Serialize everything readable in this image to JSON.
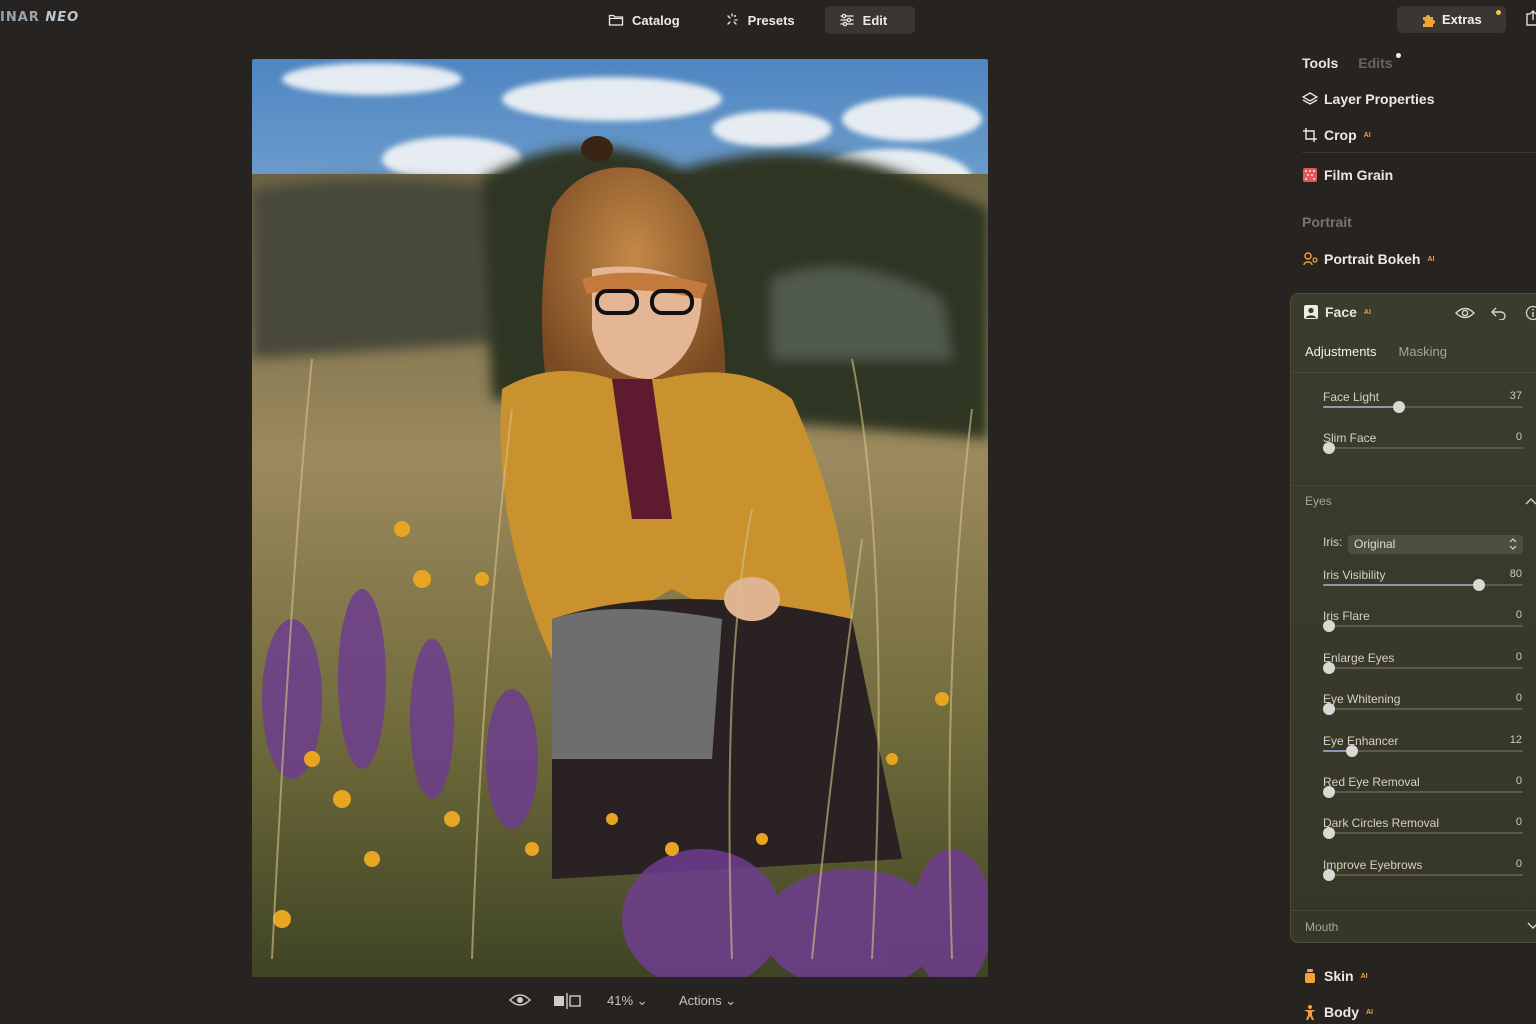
{
  "app": {
    "logo_left": "INAR",
    "logo_right": "NEO"
  },
  "topnav": {
    "catalog": "Catalog",
    "presets": "Presets",
    "edit": "Edit",
    "extras": "Extras"
  },
  "panel": {
    "tab_tools": "Tools",
    "tab_edits": "Edits",
    "layer_properties": "Layer Properties",
    "crop": "Crop",
    "film_grain": "Film Grain",
    "portrait_section": "Portrait",
    "portrait_bokeh": "Portrait Bokeh",
    "ai_badge": "AI",
    "skin": "Skin",
    "body": "Body"
  },
  "face": {
    "title": "Face",
    "subtab_adjustments": "Adjustments",
    "subtab_masking": "Masking",
    "sliders_top": [
      {
        "label": "Face Light",
        "value": "37",
        "level": 0.37
      },
      {
        "label": "Slim Face",
        "value": "0",
        "level": 0
      }
    ],
    "eyes_section": "Eyes",
    "iris_label": "Iris:",
    "iris_value": "Original",
    "sliders_eyes": [
      {
        "label": "Iris Visibility",
        "value": "80",
        "level": 0.8
      },
      {
        "label": "Iris Flare",
        "value": "0",
        "level": 0
      },
      {
        "label": "Enlarge Eyes",
        "value": "0",
        "level": 0
      },
      {
        "label": "Eye Whitening",
        "value": "0",
        "level": 0
      },
      {
        "label": "Eye Enhancer",
        "value": "12",
        "level": 0.12
      },
      {
        "label": "Red Eye Removal",
        "value": "0",
        "level": 0
      },
      {
        "label": "Dark Circles Removal",
        "value": "0",
        "level": 0
      },
      {
        "label": "Improve Eyebrows",
        "value": "0",
        "level": 0
      }
    ],
    "mouth_section": "Mouth"
  },
  "bottombar": {
    "zoom": "41%",
    "actions": "Actions"
  },
  "colors": {
    "background": "#272320",
    "accent_ai": "#f0a33a",
    "face_panel": "#3a3c2c",
    "slider_fill": "#8f95b8"
  }
}
